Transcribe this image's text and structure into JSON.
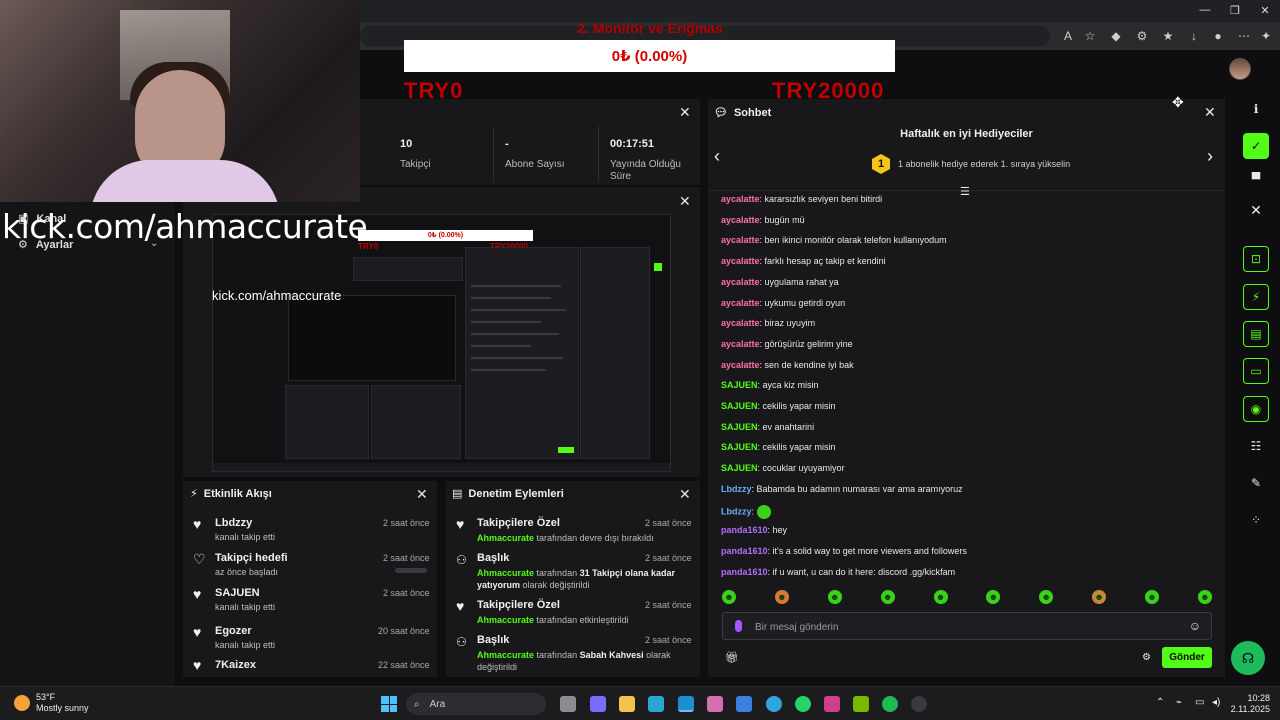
{
  "overlay": {
    "goal_title": "2. Monitör ve Eriğmas",
    "progress_text": "0₺ (0.00%)",
    "goal_min": "TRY0",
    "goal_max": "TRY20000"
  },
  "stream": {
    "kick_url": "kick.com/ahmaccurate"
  },
  "sidebar": {
    "items": [
      {
        "label": "Kanal"
      },
      {
        "label": "Ayarlar"
      }
    ]
  },
  "stats": [
    {
      "value": "10",
      "label": "Takipçi"
    },
    {
      "value": "-",
      "label": "Abone Sayısı"
    },
    {
      "value": "00:17:51",
      "label": "Yayında Olduğu Süre"
    }
  ],
  "preview": {
    "mini_progress": "0₺ (0.00%)",
    "mini_try_min": "TRY0",
    "mini_try_max": "TRY20000",
    "mini_kick_url": "kick.com/ahmaccurate"
  },
  "activity": {
    "title": "Etkinlik Akışı",
    "items": [
      {
        "name": "Lbdzzy",
        "sub": "kanalı takip etti",
        "time": "2 saat önce"
      },
      {
        "name": "Takipçi hedefi",
        "sub": "az önce başladı",
        "time": "2 saat önce"
      },
      {
        "name": "SAJUEN",
        "sub": "kanalı takip etti",
        "time": "2 saat önce"
      },
      {
        "name": "Egozer",
        "sub": "kanalı takip etti",
        "time": "20 saat önce"
      },
      {
        "name": "7Kaizex",
        "sub": "",
        "time": "22 saat önce"
      }
    ]
  },
  "moderation": {
    "title": "Denetim Eylemleri",
    "items": [
      {
        "title": "Takipçilere Özel",
        "actor": "Ahmaccurate",
        "text": "tarafından devre dışı bırakıldı",
        "time": "2 saat önce"
      },
      {
        "title": "Başlık",
        "actor": "Ahmaccurate",
        "pre": "tarafından",
        "value": "31 Takipçi olana kadar yatıyorum",
        "post": "olarak değiştirildi",
        "time": "2 saat önce"
      },
      {
        "title": "Takipçilere Özel",
        "actor": "Ahmaccurate",
        "text": "tarafından etkinleştirildi",
        "time": "2 saat önce"
      },
      {
        "title": "Başlık",
        "actor": "Ahmaccurate",
        "pre": "tarafından",
        "value": "Sabah Kahvesi",
        "post": "olarak değiştirildi",
        "time": "2 saat önce"
      }
    ]
  },
  "chat": {
    "title": "Sohbet",
    "gifters_title": "Haftalık en iyi Hediyeciler",
    "gifters_badge": "1",
    "gifters_sub": "1 abonelik hediye ederek 1. sıraya yükselin",
    "messages": [
      {
        "user": "aycalatte",
        "color": "#ff6fa8",
        "text": "kararsızlık seviyen beni bitirdi"
      },
      {
        "user": "aycalatte",
        "color": "#ff6fa8",
        "text": "bugün mü"
      },
      {
        "user": "aycalatte",
        "color": "#ff6fa8",
        "text": "ben ikinci monitör olarak telefon kullanıyodum"
      },
      {
        "user": "aycalatte",
        "color": "#ff6fa8",
        "text": "farklı hesap aç takip et kendini"
      },
      {
        "user": "aycalatte",
        "color": "#ff6fa8",
        "text": "uygulama rahat ya"
      },
      {
        "user": "aycalatte",
        "color": "#ff6fa8",
        "text": "uykumu getirdi oyun"
      },
      {
        "user": "aycalatte",
        "color": "#ff6fa8",
        "text": "biraz uyuyim"
      },
      {
        "user": "aycalatte",
        "color": "#ff6fa8",
        "text": "görüşürüz gelirim yine"
      },
      {
        "user": "aycalatte",
        "color": "#ff6fa8",
        "text": "sen de kendine iyi bak"
      },
      {
        "user": "SAJUEN",
        "color": "#53fc18",
        "text": "ayca kiz misin"
      },
      {
        "user": "SAJUEN",
        "color": "#53fc18",
        "text": "cekilis yapar misin"
      },
      {
        "user": "SAJUEN",
        "color": "#53fc18",
        "text": "ev anahtarini"
      },
      {
        "user": "SAJUEN",
        "color": "#53fc18",
        "text": "cekilis yapar misin"
      },
      {
        "user": "SAJUEN",
        "color": "#53fc18",
        "text": "cocuklar uyuyamiyor"
      },
      {
        "user": "Lbdzzy",
        "color": "#6fa8ff",
        "text": "Babamda bu adamın numarası var ama aramıyoruz"
      },
      {
        "user": "Lbdzzy",
        "color": "#6fa8ff",
        "text": ""
      },
      {
        "user": "panda1610",
        "color": "#b06fff",
        "text": "hey"
      },
      {
        "user": "panda1610",
        "color": "#b06fff",
        "text": "it's a solid way to get more viewers and followers"
      },
      {
        "user": "panda1610",
        "color": "#b06fff",
        "text": "if u want, u can do it here: discord .gg/kickfam"
      }
    ],
    "input_placeholder": "Bir mesaj gönderin",
    "send_label": "Gönder"
  },
  "taskbar": {
    "weather_temp": "53°F",
    "weather_desc": "Mostly sunny",
    "search_label": "Ara",
    "time": "10:28",
    "date": "2.11.2025"
  },
  "colors": {
    "accent": "#53fc18",
    "goal_red": "#c00000"
  }
}
